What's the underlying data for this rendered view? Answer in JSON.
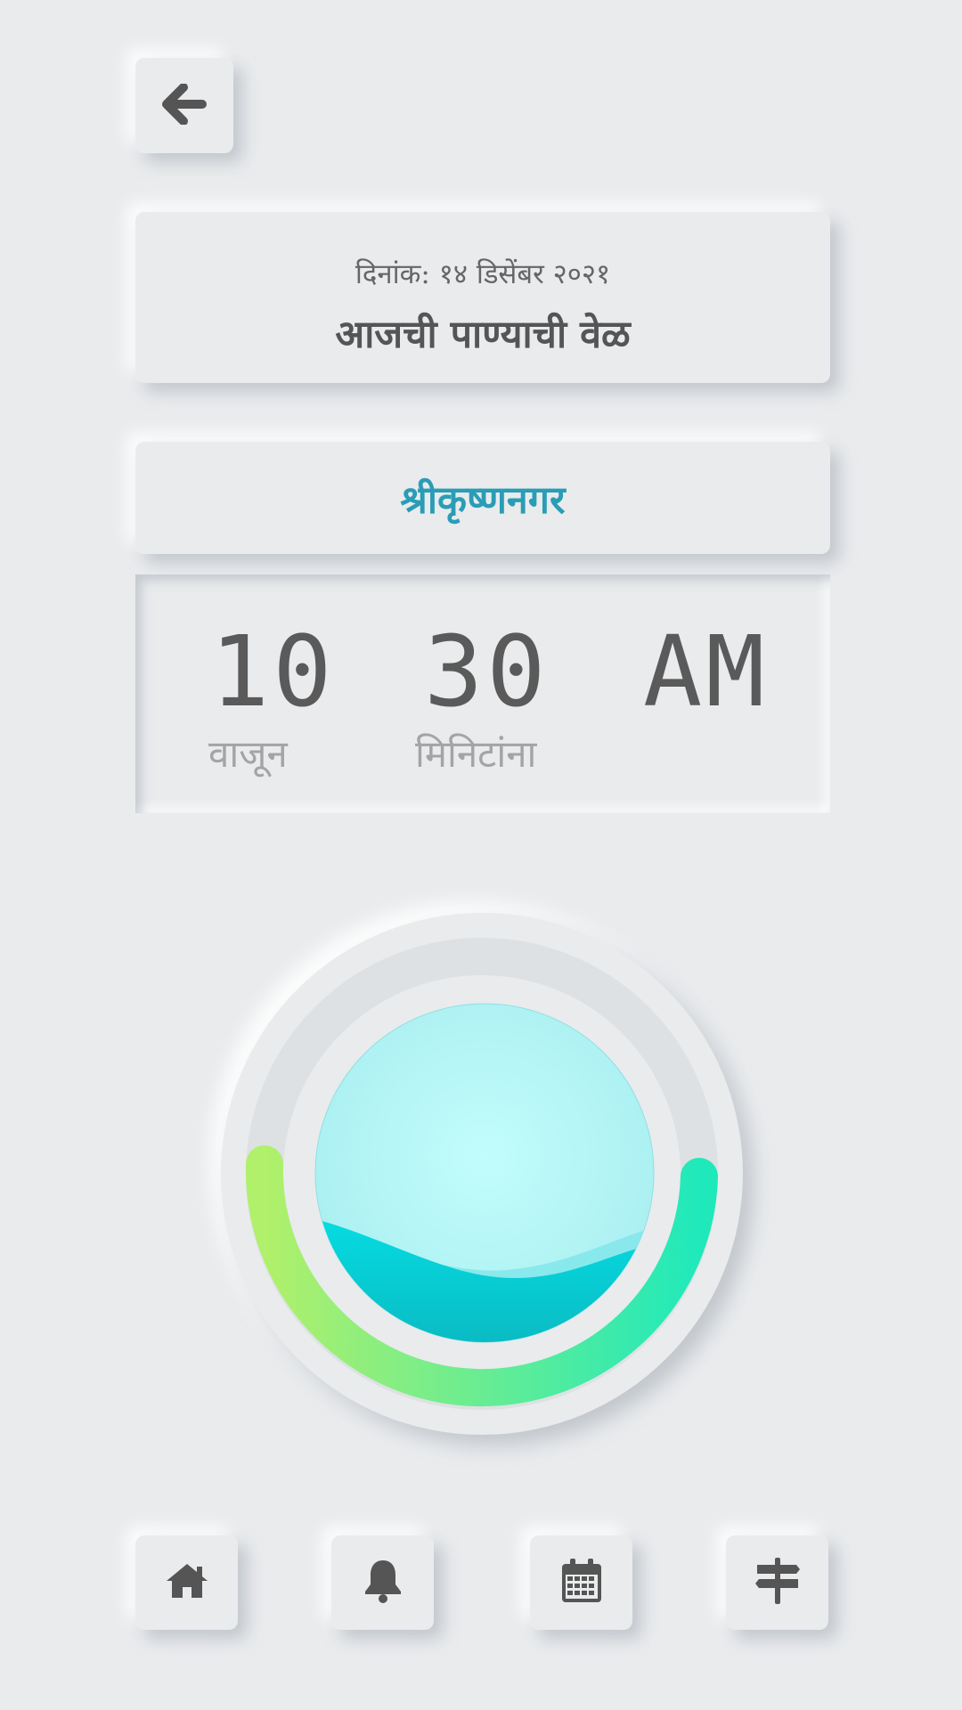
{
  "header": {
    "date": "दिनांक: १४ डिसेंबर २०२१",
    "title": "आजची पाण्याची वेळ"
  },
  "area": {
    "name": "श्रीकृष्णनगर"
  },
  "time": {
    "hour": "10",
    "minute": "30",
    "period": "AM",
    "hour_label": "वाजून",
    "minute_label": "मिनिटांना"
  },
  "gauge": {
    "level_fraction": 0.3,
    "colors": {
      "arc_start": "#b1f06a",
      "arc_end": "#1fe9bb",
      "water": "#05d6dc"
    }
  },
  "icons": {
    "back": "arrow-left-icon",
    "nav": [
      "home-icon",
      "bell-icon",
      "calendar-icon",
      "signpost-icon"
    ]
  },
  "colors": {
    "background": "#e9ebed",
    "accent": "#2a9db6",
    "text": "#555555"
  }
}
